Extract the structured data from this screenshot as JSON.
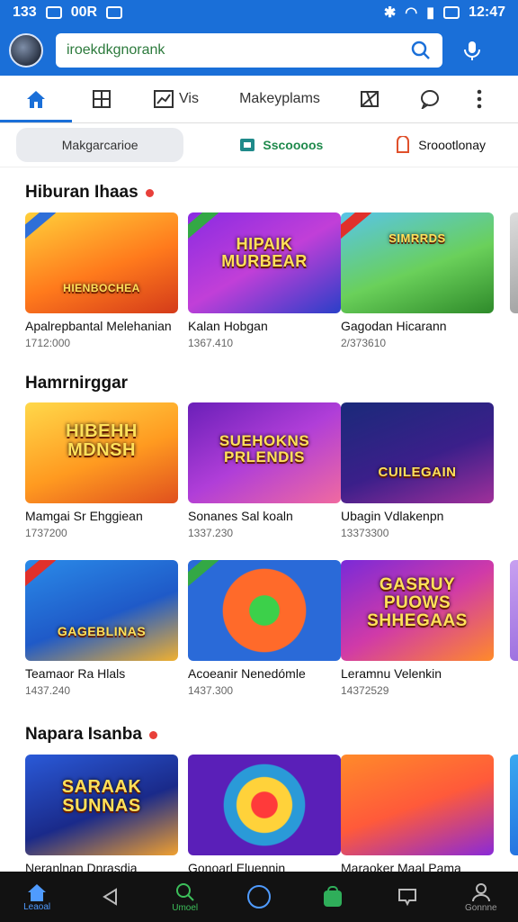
{
  "status": {
    "left": "133",
    "mid": "00R",
    "time": "12:47"
  },
  "search": {
    "value": "iroekdkgnorank"
  },
  "tabs": [
    {
      "label": ""
    },
    {
      "label": ""
    },
    {
      "label": "Vis"
    },
    {
      "label": "Makeyplams"
    },
    {
      "label": ""
    },
    {
      "label": ""
    }
  ],
  "chips": [
    {
      "label": "Makgarcarioe"
    },
    {
      "label": "Sscoooos"
    },
    {
      "label": "Sroootlonay"
    }
  ],
  "sections": [
    {
      "title": "Hiburan Ihaas"
    },
    {
      "title": "Hamrnirggar"
    },
    {
      "title": "Napara Isanba"
    }
  ],
  "rows": [
    [
      {
        "name": "Apalrepbantal Melehanian",
        "count": "1712:000",
        "logo": "HIENBOCHEA"
      },
      {
        "name": "Kalan Hobgan",
        "count": "1367.410",
        "logo": "HIPAIK MURBEAR"
      },
      {
        "name": "Gagodan Hicarann",
        "count": "2/373610",
        "logo": "SIMRRDS"
      }
    ],
    [
      {
        "name": "Mamgai Sr Ehggiean",
        "count": "1737200",
        "logo": "HIBEHH MDNSH"
      },
      {
        "name": "Sonanes Sal koaln",
        "count": "1337.230",
        "logo": "SUEHOKNS PRLENDIS"
      },
      {
        "name": "Ubagin Vdlakenpn",
        "count": "13373300",
        "logo": "CUILEGAIN"
      }
    ],
    [
      {
        "name": "Teamaor Ra Hlals",
        "count": "1437.240",
        "logo": "GAGEBLINAS"
      },
      {
        "name": "Acoeanir Nenedómle",
        "count": "1437.300",
        "logo": ""
      },
      {
        "name": "Leramnu Velenkin",
        "count": "14372529",
        "logo": "GASRUY PUOWS SHHEGAAS"
      }
    ],
    [
      {
        "name": "Neranlnan Dnrasdia",
        "count": "",
        "logo": "SARAAK SUNNAS"
      },
      {
        "name": "Gonoarl Eluennin",
        "count": "",
        "logo": ""
      },
      {
        "name": "Maraoker Maal Pama",
        "count": "",
        "logo": ""
      }
    ]
  ],
  "nav": [
    {
      "label": "Leaoal"
    },
    {
      "label": ""
    },
    {
      "label": "Umoel"
    },
    {
      "label": ""
    },
    {
      "label": ""
    },
    {
      "label": ""
    },
    {
      "label": "Gonnne"
    }
  ],
  "colors": {
    "brand": "#1a6fd8",
    "accent": "#e8403a",
    "navbar": "#121212"
  }
}
